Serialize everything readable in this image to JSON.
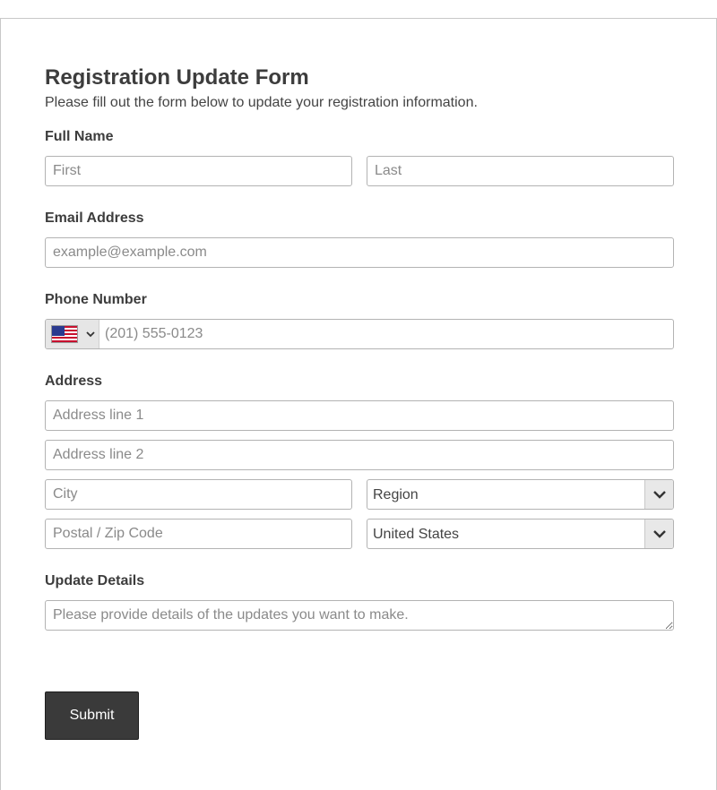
{
  "form": {
    "title": "Registration Update Form",
    "subtitle": "Please fill out the form below to update your registration information."
  },
  "full_name": {
    "label": "Full Name",
    "first_placeholder": "First",
    "last_placeholder": "Last"
  },
  "email": {
    "label": "Email Address",
    "placeholder": "example@example.com"
  },
  "phone": {
    "label": "Phone Number",
    "country_flag": "us-flag-icon",
    "placeholder": "(201) 555-0123"
  },
  "address": {
    "label": "Address",
    "line1_placeholder": "Address line 1",
    "line2_placeholder": "Address line 2",
    "city_placeholder": "City",
    "region_value": "Region",
    "postal_placeholder": "Postal / Zip Code",
    "country_value": "United States"
  },
  "update_details": {
    "label": "Update Details",
    "placeholder": "Please provide details of the updates you want to make."
  },
  "submit": {
    "label": "Submit"
  },
  "colors": {
    "button_bg": "#3a3a3a",
    "input_border": "#b3b3b3",
    "text": "#444444"
  }
}
